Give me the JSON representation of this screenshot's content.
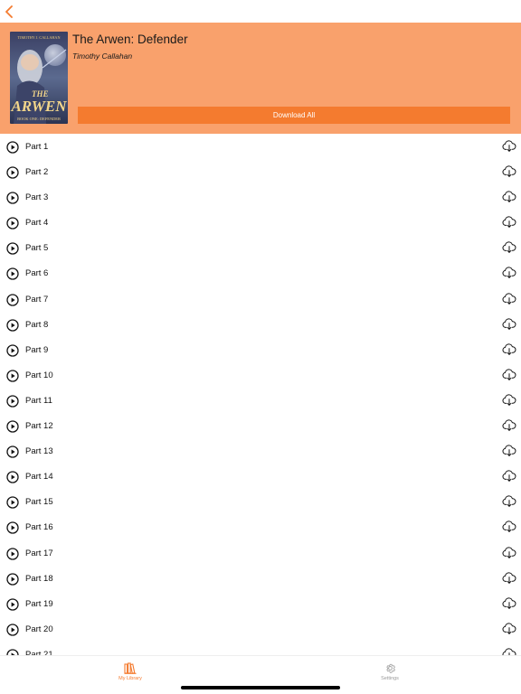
{
  "nav": {
    "back_icon": "chevron-left-icon"
  },
  "book": {
    "title": "The Arwen: Defender",
    "author": "Timothy Callahan",
    "cover": {
      "author_text": "TIMOTHY J. CALLAHAN",
      "title_line1": "THE",
      "title_line2": "ARWEN",
      "subtitle": "BOOK ONE: DEFENDER"
    }
  },
  "actions": {
    "download_all_label": "Download All"
  },
  "parts": [
    {
      "label": "Part 1"
    },
    {
      "label": "Part 2"
    },
    {
      "label": "Part 3"
    },
    {
      "label": "Part 4"
    },
    {
      "label": "Part 5"
    },
    {
      "label": "Part 6"
    },
    {
      "label": "Part 7"
    },
    {
      "label": "Part 8"
    },
    {
      "label": "Part 9"
    },
    {
      "label": "Part 10"
    },
    {
      "label": "Part 11"
    },
    {
      "label": "Part 12"
    },
    {
      "label": "Part 13"
    },
    {
      "label": "Part 14"
    },
    {
      "label": "Part 15"
    },
    {
      "label": "Part 16"
    },
    {
      "label": "Part 17"
    },
    {
      "label": "Part 18"
    },
    {
      "label": "Part 19"
    },
    {
      "label": "Part 20"
    },
    {
      "label": "Part 21"
    }
  ],
  "tabs": {
    "library": {
      "label": "My Library",
      "icon": "books-icon",
      "active": true
    },
    "settings": {
      "label": "Settings",
      "icon": "gear-icon",
      "active": false
    }
  },
  "colors": {
    "accent": "#f47b2f",
    "header_bg": "#f9a16c",
    "inactive_tab": "#9a9a9a"
  }
}
